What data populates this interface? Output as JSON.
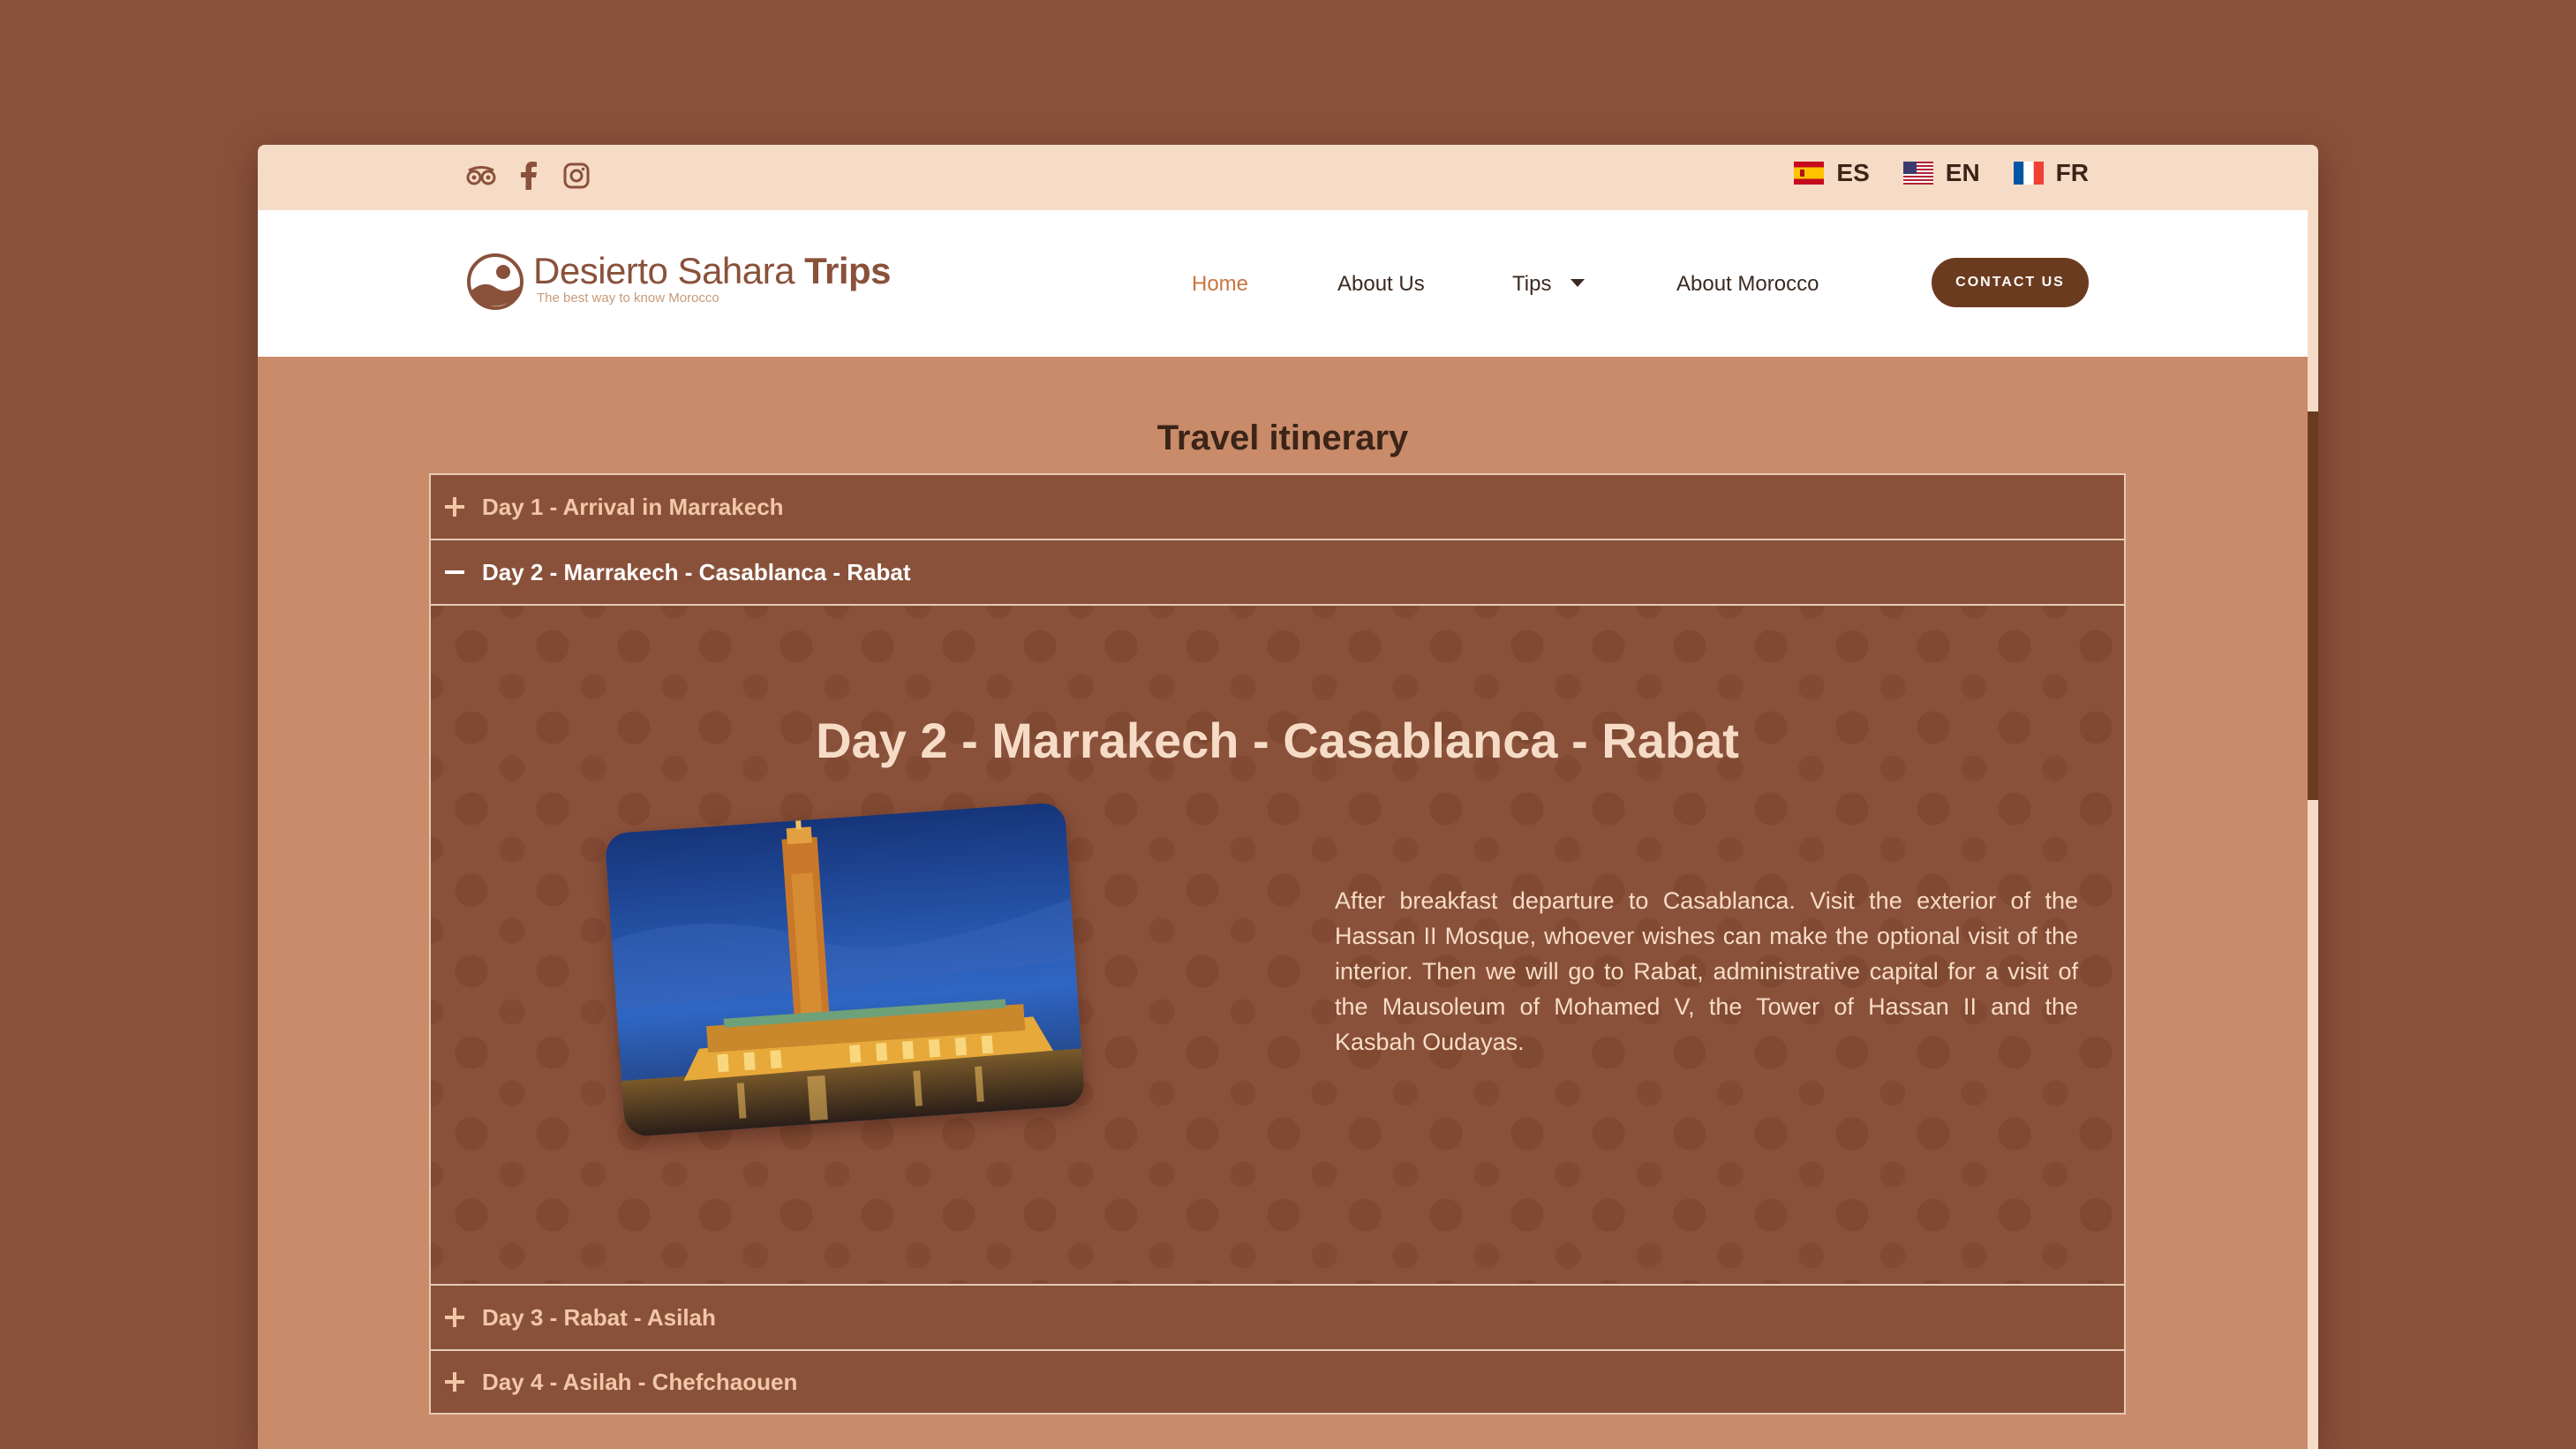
{
  "social": {
    "icons": [
      "tripadvisor-icon",
      "facebook-icon",
      "instagram-icon"
    ]
  },
  "languages": [
    {
      "code": "ES",
      "flag": "spain-flag-icon"
    },
    {
      "code": "EN",
      "flag": "usa-flag-icon"
    },
    {
      "code": "FR",
      "flag": "france-flag-icon"
    }
  ],
  "brand": {
    "title_light": "Desierto Sahara ",
    "title_bold": "Trips",
    "tagline": "The best way to know Morocco"
  },
  "nav": {
    "home": "Home",
    "about_us": "About Us",
    "tips": "Tips",
    "about_morocco": "About Morocco",
    "contact": "CONTACT US"
  },
  "itinerary": {
    "title": "Travel itinerary",
    "days": [
      {
        "label": "Day 1 - Arrival in Marrakech",
        "open": false
      },
      {
        "label": "Day 2 - Marrakech - Casablanca - Rabat",
        "open": true
      },
      {
        "label": "Day 3 - Rabat - Asilah",
        "open": false
      },
      {
        "label": "Day 4 - Asilah - Chefchaouen",
        "open": false
      }
    ],
    "open_day": {
      "heading": "Day 2 - Marrakech - Casablanca - Rabat",
      "image_alt": "Hassan II Mosque at night",
      "description": "After breakfast departure to Casablanca. Visit the exterior of the Hassan II Mosque, whoever wishes can make the optional visit of the interior. Then we will go to Rabat, administrative capital for a visit of the Mausoleum of Mohamed V, the Tower of Hassan II and the Kasbah Oudayas."
    }
  },
  "colors": {
    "page_bg": "#8a513a",
    "content_bg": "#c98b69",
    "topbar_bg": "#f6dcc6",
    "accent": "#6b3b1f",
    "active_link": "#c9763f"
  }
}
